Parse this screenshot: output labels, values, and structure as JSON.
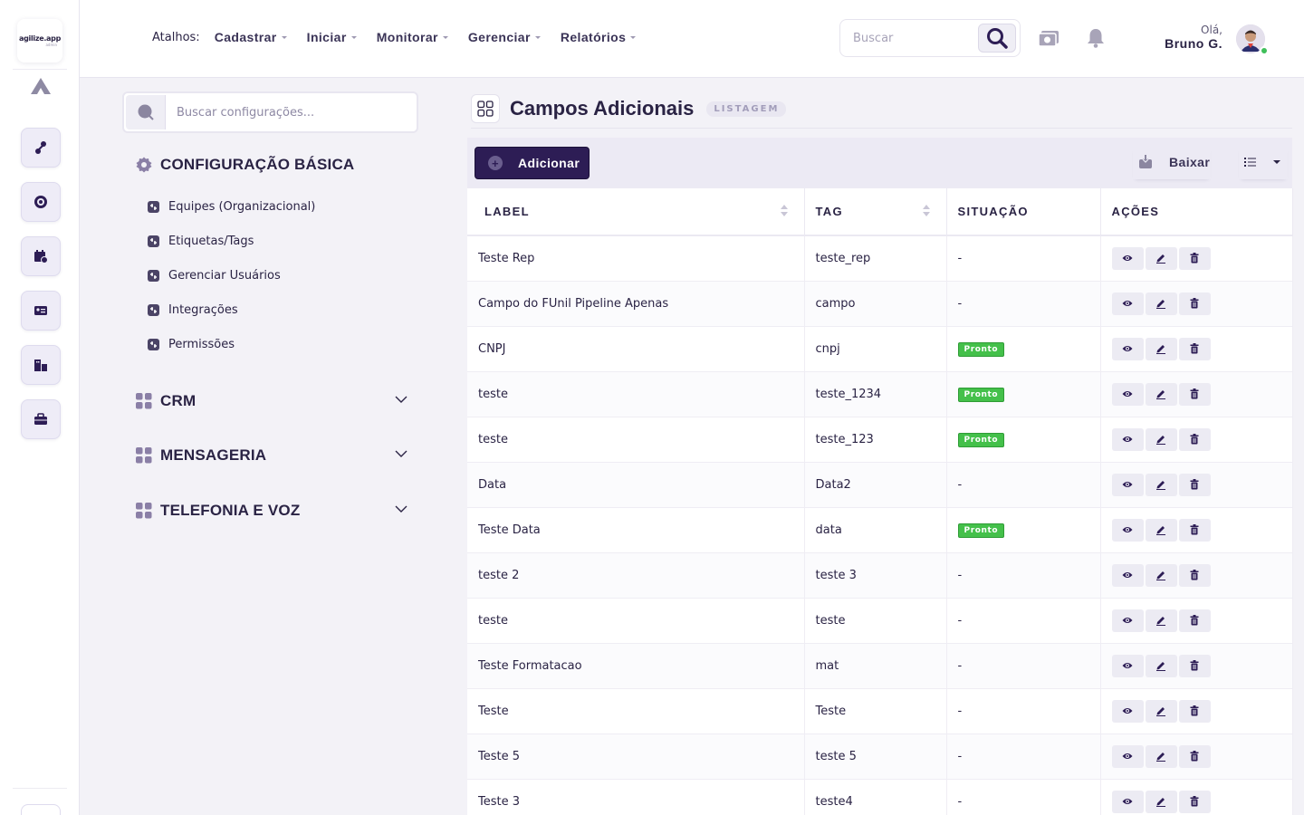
{
  "brand": {
    "logo_text": "agilize.app",
    "logo_sub": "admin"
  },
  "topbar": {
    "shortcuts_label": "Atalhos:",
    "menu": [
      {
        "label": "Cadastrar"
      },
      {
        "label": "Iniciar"
      },
      {
        "label": "Monitorar"
      },
      {
        "label": "Gerenciar"
      },
      {
        "label": "Relatórios"
      }
    ],
    "search_placeholder": "Buscar",
    "greeting": "Olá,",
    "user_name": "Bruno G.",
    "user_status_color": "#3fbf5a"
  },
  "rail": {
    "icons": [
      "integrations-icon",
      "target-icon",
      "calendar-icon",
      "contact-card-icon",
      "company-icon",
      "briefcase-icon"
    ]
  },
  "settings": {
    "search_placeholder": "Buscar configurações...",
    "basic_title": "CONFIGURAÇÃO BÁSICA",
    "basic_items": [
      {
        "label": "Equipes (Organizacional)"
      },
      {
        "label": "Etiquetas/Tags"
      },
      {
        "label": "Gerenciar Usuários"
      },
      {
        "label": "Integrações"
      },
      {
        "label": "Permissões"
      }
    ],
    "sections": [
      {
        "label": "CRM"
      },
      {
        "label": "MENSAGERIA"
      },
      {
        "label": "TELEFONIA E VOZ"
      }
    ]
  },
  "main": {
    "title": "Campos Adicionais",
    "badge": "LISTAGEM",
    "add_label": "Adicionar",
    "download_label": "Baixar",
    "columns": {
      "label": "LABEL",
      "tag": "TAG",
      "status": "SITUAÇÃO",
      "actions": "AÇÕES"
    },
    "status_ready_color": "#44c04a",
    "rows": [
      {
        "label": "Teste Rep",
        "tag": "teste_rep",
        "status": "-"
      },
      {
        "label": "Campo do FUnil Pipeline Apenas",
        "tag": "campo",
        "status": "-"
      },
      {
        "label": "CNPJ",
        "tag": "cnpj",
        "status": "Pronto"
      },
      {
        "label": "teste",
        "tag": "teste_1234",
        "status": "Pronto"
      },
      {
        "label": "teste",
        "tag": "teste_123",
        "status": "Pronto"
      },
      {
        "label": "Data",
        "tag": "Data2",
        "status": "-"
      },
      {
        "label": "Teste Data",
        "tag": "data",
        "status": "Pronto"
      },
      {
        "label": "teste 2",
        "tag": "teste 3",
        "status": "-"
      },
      {
        "label": "teste",
        "tag": "teste",
        "status": "-"
      },
      {
        "label": "Teste Formatacao",
        "tag": "mat",
        "status": "-"
      },
      {
        "label": "Teste",
        "tag": "Teste",
        "status": "-"
      },
      {
        "label": "Teste 5",
        "tag": "teste 5",
        "status": "-"
      },
      {
        "label": "Teste 3",
        "tag": "teste4",
        "status": "-"
      }
    ]
  }
}
